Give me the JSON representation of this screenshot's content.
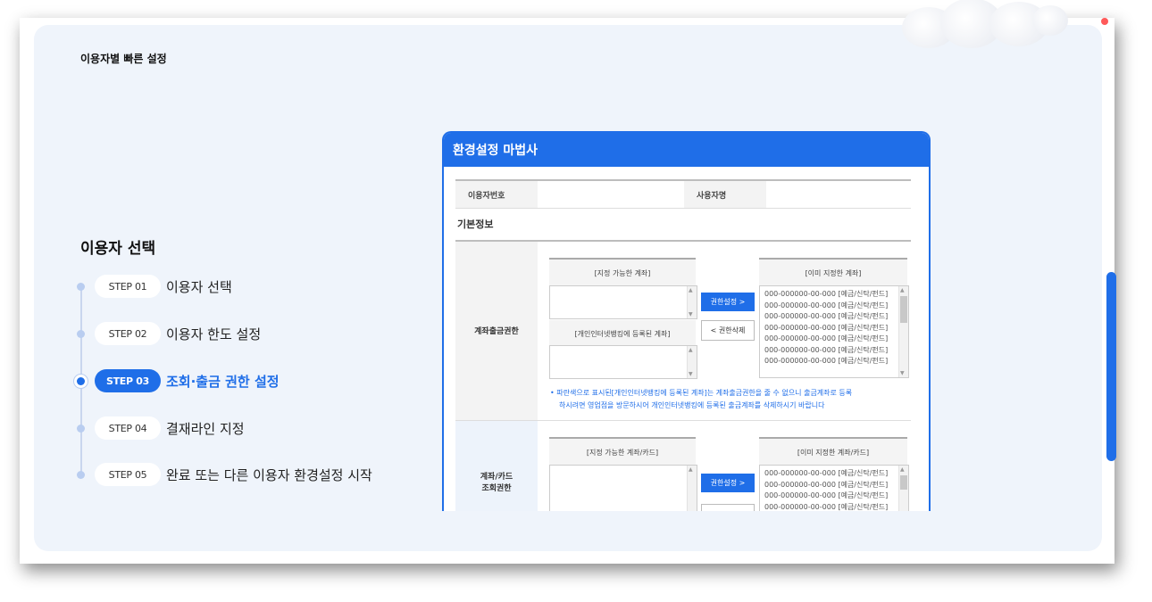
{
  "page_title": "이용자별 빠른 설정",
  "section_title": "이용자 선택",
  "steps": [
    {
      "badge": "STEP 01",
      "label": "이용자 선택",
      "active": false
    },
    {
      "badge": "STEP 02",
      "label": "이용자 한도 설정",
      "active": false
    },
    {
      "badge": "STEP 03",
      "label": "조회·출금 권한 설정",
      "active": true
    },
    {
      "badge": "STEP 04",
      "label": "결재라인 지정",
      "active": false
    },
    {
      "badge": "STEP 05",
      "label": "완료 또는 다른 이용자 환경설정 시작",
      "active": false
    }
  ],
  "wizard": {
    "title": "환경설정 마법사",
    "user_no_label": "이용자번호",
    "user_name_label": "사용자명",
    "basic_info": "기본정보",
    "withdraw_section": {
      "label": "계좌출금권한",
      "available_header": "[지정 가능한 계좌]",
      "registered_header": "[개인인터넷뱅킹에 등록된 계좌]",
      "assigned_header": "[이미 지정한 계좌]",
      "grant_button": "권한설정  >",
      "revoke_button": "<   권한삭제",
      "accounts": [
        "000-000000-00-000 [예금/신탁/펀드]",
        "000-000000-00-000 [예금/신탁/펀드]",
        "000-000000-00-000 [예금/신탁/펀드]",
        "000-000000-00-000 [예금/신탁/펀드]",
        "000-000000-00-000 [예금/신탁/펀드]",
        "000-000000-00-000 [예금/신탁/펀드]",
        "000-000000-00-000 [예금/신탁/펀드]"
      ],
      "note_line1": "• 파란색으로 표시된[개인인터넷뱅킹에 등록된 계좌]는 계좌출금권한을 줄 수 없으니 출금계좌로 등록",
      "note_line2": "하시려면 영업점을 방문하시어 개인인터넷뱅킹에 등록된 출금계좌를 삭제하시기 바랍니다"
    },
    "inquiry_section": {
      "label_line1": "계좌/카드",
      "label_line2": "조회권한",
      "available_header": "[지정 가능한 계좌/카드]",
      "assigned_header": "[이미 지정한 계좌/카드]",
      "grant_button": "권한설정  >",
      "accounts": [
        "000-000000-00-000 [예금/신탁/펀드]",
        "000-000000-00-000 [예금/신탁/펀드]",
        "000-000000-00-000 [예금/신탁/펀드]",
        "000-000000-00-000 [예금/신탁/펀드]"
      ]
    }
  }
}
